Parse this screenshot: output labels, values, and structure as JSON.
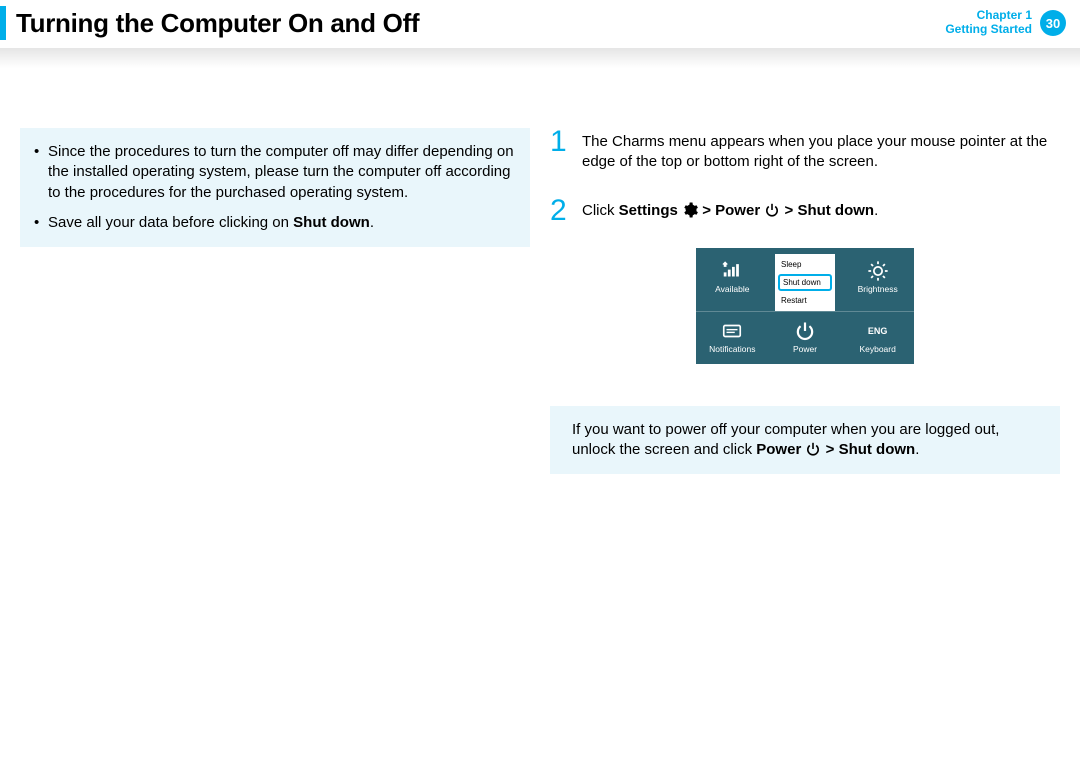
{
  "header": {
    "title": "Turning the Computer On and Off",
    "chapter_line1": "Chapter 1",
    "chapter_line2": "Getting Started",
    "page_number": "30"
  },
  "tips": {
    "item1_a": "Since the procedures to turn the computer off may differ depending on the installed operating system, please turn the computer off according to the procedures for the purchased operating system.",
    "item2_a": "Save all your data before clicking on ",
    "item2_bold": "Shut down",
    "item2_b": "."
  },
  "steps": {
    "s1_num": "1",
    "s1_text": "The Charms menu appears when you place your mouse pointer at the edge of the top or bottom right of the screen.",
    "s2_num": "2",
    "s2_pre": "Click ",
    "s2_settings": "Settings",
    "s2_sep1": " > ",
    "s2_power": "Power",
    "s2_sep2": " > ",
    "s2_shut": "Shut down",
    "s2_post": "."
  },
  "charms": {
    "available": "Available",
    "brightness": "Brightness",
    "notifications": "Notifications",
    "power": "Power",
    "keyboard": "Keyboard",
    "eng": "ENG",
    "menu_sleep": "Sleep",
    "menu_shutdown": "Shut down",
    "menu_restart": "Restart"
  },
  "note": {
    "a": "If you want to power off your computer when you are logged out, unlock the screen and click ",
    "power": "Power",
    "sep": " > ",
    "shut": "Shut down",
    "b": "."
  }
}
